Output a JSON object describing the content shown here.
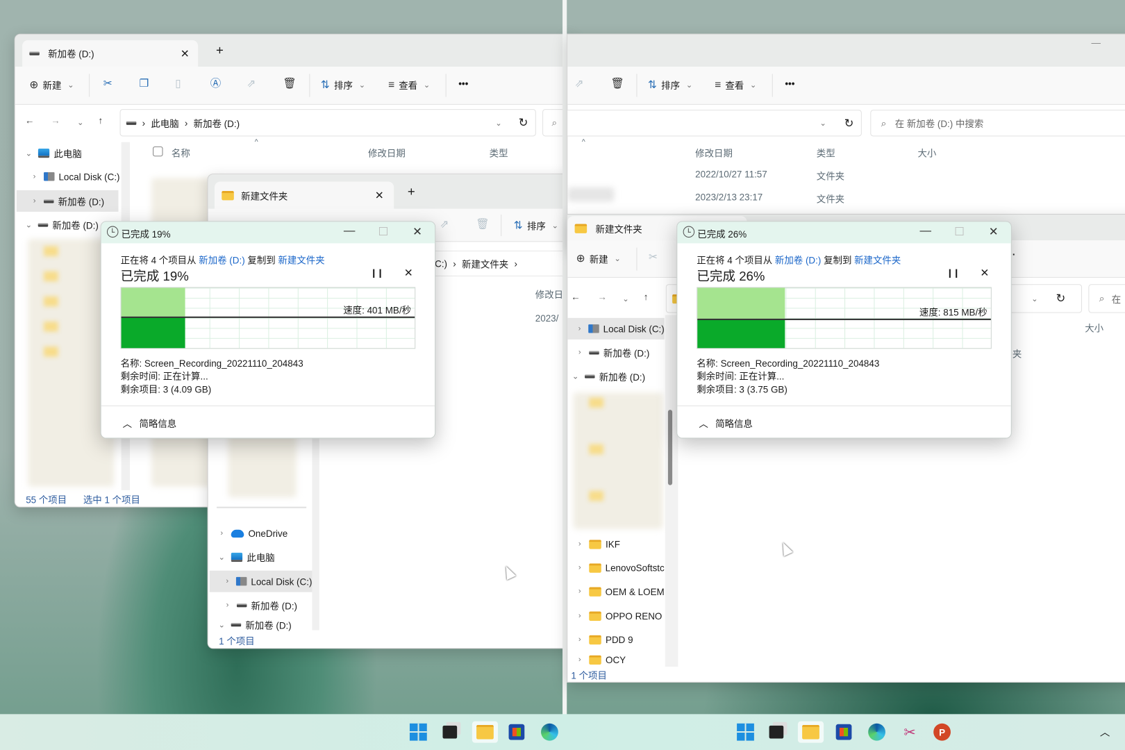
{
  "left_window": {
    "tab_title": "新加卷 (D:)",
    "new_tab": "+",
    "toolbar": {
      "new": "新建",
      "sort": "排序",
      "view": "查看",
      "more": "•••"
    },
    "breadcrumb": [
      "此电脑",
      "新加卷 (D:)"
    ],
    "nav": [
      "此电脑",
      "Local Disk (C:)",
      "新加卷 (D:)",
      "新加卷 (D:)"
    ],
    "columns": [
      "名称",
      "修改日期",
      "类型"
    ],
    "status": {
      "count": "55 个项目",
      "selected": "选中 1 个项目"
    }
  },
  "mid_window": {
    "tab_title": "新建文件夹",
    "new_tab": "+",
    "sort": "排序",
    "breadcrumb": [
      "C:)",
      "新建文件夹"
    ],
    "column": "修改日",
    "row_date": "2023/",
    "nav": [
      "OneDrive",
      "此电脑",
      "Local Disk (C:)",
      "新加卷 (D:)",
      "新加卷 (D:)"
    ],
    "status": "1 个项目"
  },
  "dialog_left": {
    "title": "已完成 19%",
    "line_prefix": "正在将 4 个项目从 ",
    "source": "新加卷 (D:)",
    "line_mid": " 复制到 ",
    "dest": "新建文件夹",
    "heading": "已完成 19%",
    "progress_percent": 19,
    "speed": "速度: 401 MB/秒",
    "name": "名称: Screen_Recording_20221110_204843",
    "time_left": "剩余时间: 正在计算...",
    "items_left": "剩余项目: 3 (4.09 GB)",
    "less_details": "简略信息"
  },
  "dialog_right": {
    "title": "已完成 26%",
    "line_prefix": "正在将 4 个项目从 ",
    "source": "新加卷 (D:)",
    "line_mid": " 复制到 ",
    "dest": "新建文件夹",
    "heading": "已完成 26%",
    "progress_percent": 26,
    "speed": "速度: 815 MB/秒",
    "name": "名称: Screen_Recording_20221110_204843",
    "time_left": "剩余时间: 正在计算...",
    "items_left": "剩余项目: 3 (3.75 GB)",
    "less_details": "简略信息"
  },
  "right_back_window": {
    "sort": "排序",
    "view": "查看",
    "more": "•••",
    "search_placeholder": "在 新加卷 (D:) 中搜索",
    "columns": [
      "修改日期",
      "类型",
      "大小"
    ],
    "rows": [
      {
        "date": "2022/10/27 11:57",
        "type": "文件夹"
      },
      {
        "date": "2023/2/13 23:17",
        "type": "文件夹"
      }
    ]
  },
  "right_front_window": {
    "tab_title": "新建文件夹",
    "new": "新建",
    "search_partial": "在",
    "column": "大小",
    "type_partial": "夹",
    "nav": [
      "Local Disk (C:)",
      "新加卷 (D:)",
      "新加卷 (D:)",
      "IKF",
      "LenovoSoftstc",
      "OEM & LOEM",
      "OPPO RENO",
      "PDD 9",
      "OCY"
    ],
    "status": "1 个项目"
  },
  "colors": {
    "progress_dark": "#0aaa2a",
    "progress_light": "#a5e48f",
    "link": "#1a66c9",
    "dialog_titlebar": "#e4f5ee"
  }
}
